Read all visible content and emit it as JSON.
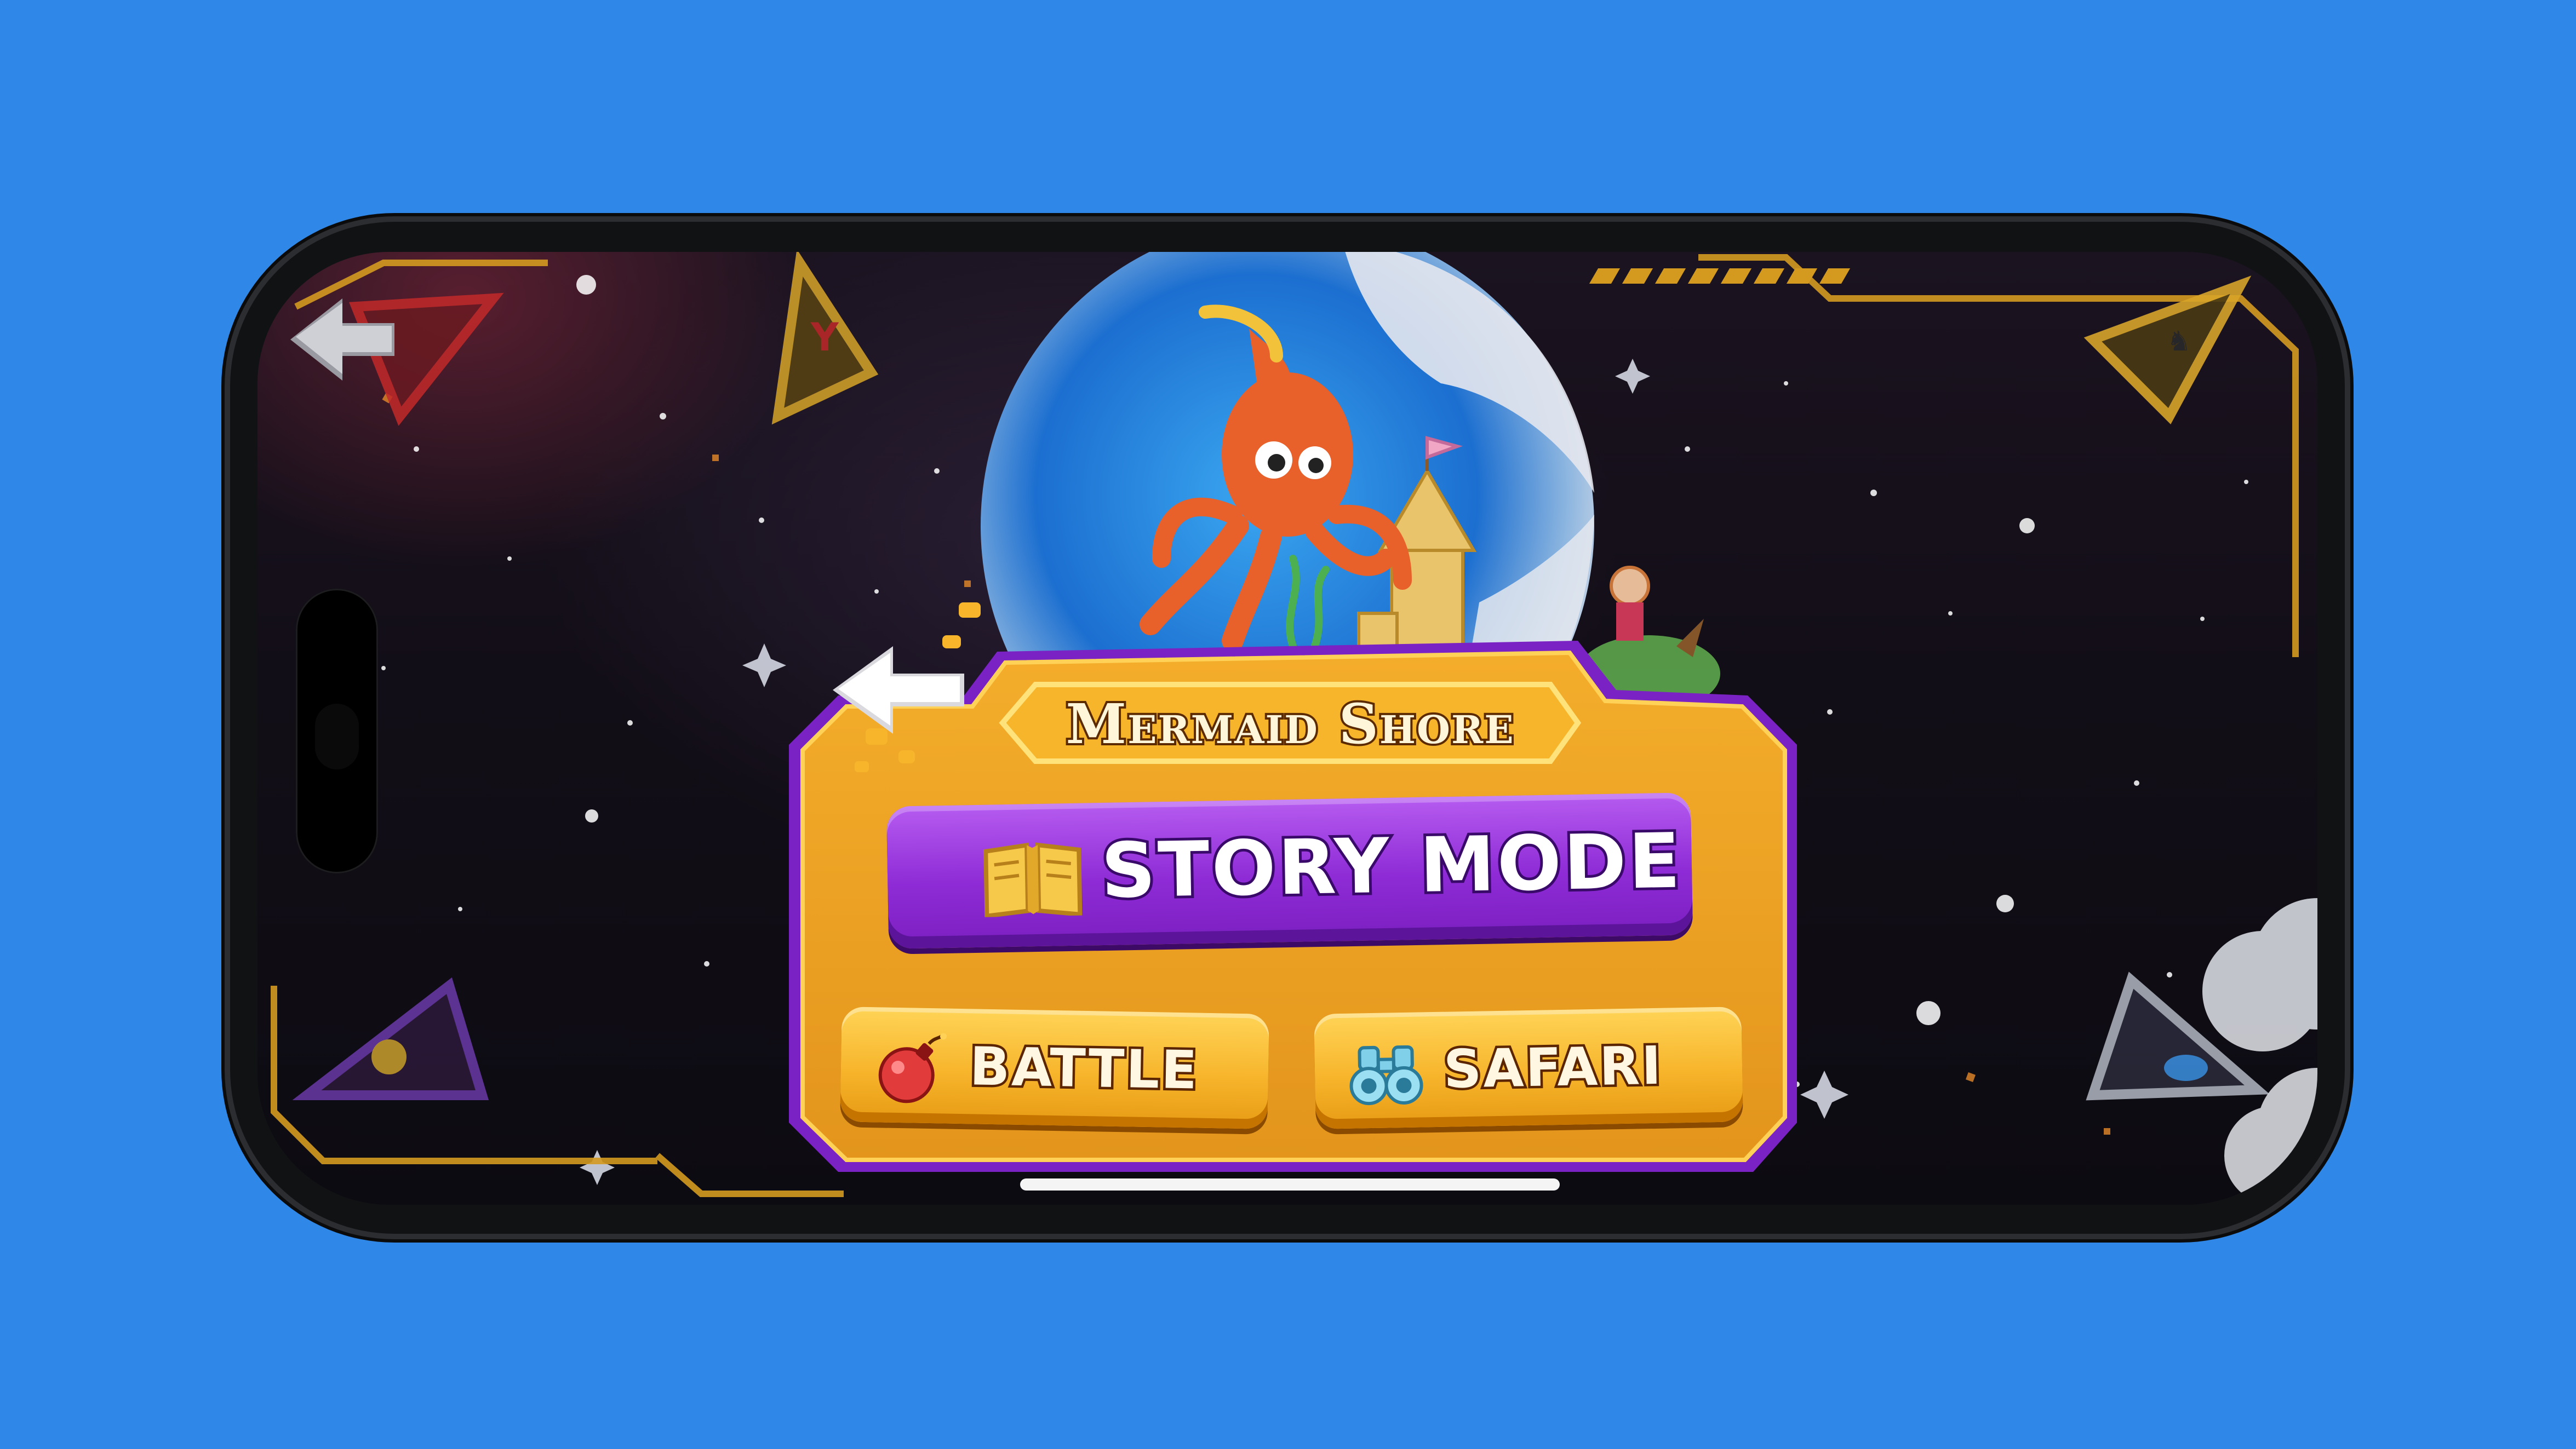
{
  "game": {
    "world_name": "Mermaid Shore",
    "buttons": {
      "story_mode": "STORY MODE",
      "battle": "BATTLE",
      "safari": "SAFARI"
    }
  },
  "icons": {
    "back": "back-arrow-icon",
    "story": "open-book-icon",
    "battle": "bomb-icon",
    "safari": "binoculars-icon"
  },
  "colors": {
    "background": "#2f88e8",
    "panel_orange": "#f2a626",
    "panel_purple": "#8e2bd6",
    "button_yellow": "#f7b52c"
  }
}
